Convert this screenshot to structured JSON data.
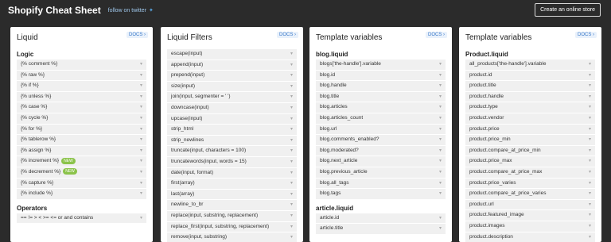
{
  "header": {
    "title": "Shopify Cheat Sheet",
    "twitter_label": "follow on twitter",
    "store_button": "Create an online store"
  },
  "panels": [
    {
      "title": "Liquid",
      "docs": "DOCS",
      "sections": [
        {
          "title": "Logic",
          "items": [
            {
              "label": "{% comment %}"
            },
            {
              "label": "{% raw %}"
            },
            {
              "label": "{% if %}"
            },
            {
              "label": "{% unless %}"
            },
            {
              "label": "{% case %}"
            },
            {
              "label": "{% cycle %}"
            },
            {
              "label": "{% for %}"
            },
            {
              "label": "{% tablerow %}"
            },
            {
              "label": "{% assign %}"
            },
            {
              "label": "{% increment %}",
              "badge": "NEW"
            },
            {
              "label": "{% decrement %}",
              "badge": "NEW"
            },
            {
              "label": "{% capture %}"
            },
            {
              "label": "{% include %}"
            }
          ]
        },
        {
          "title": "Operators",
          "items": [
            {
              "label": "== != > < >= <= or and contains"
            }
          ]
        }
      ]
    },
    {
      "title": "Liquid Filters",
      "docs": "DOCS",
      "sections": [
        {
          "title": "",
          "items": [
            {
              "label": "escape(input)"
            },
            {
              "label": "append(input)"
            },
            {
              "label": "prepend(input)"
            },
            {
              "label": "size(input)"
            },
            {
              "label": "join(input, segmenter = ' ')"
            },
            {
              "label": "downcase(input)"
            },
            {
              "label": "upcase(input)"
            },
            {
              "label": "strip_html"
            },
            {
              "label": "strip_newlines"
            },
            {
              "label": "truncate(input, characters = 100)"
            },
            {
              "label": "truncatewords(input, words = 15)"
            },
            {
              "label": "date(input, format)"
            },
            {
              "label": "first(array)"
            },
            {
              "label": "last(array)"
            },
            {
              "label": "newline_to_br"
            },
            {
              "label": "replace(input, substring, replacement)"
            },
            {
              "label": "replace_first(input, substring, replacement)"
            },
            {
              "label": "remove(input, substring)"
            }
          ]
        }
      ]
    },
    {
      "title": "Template variables",
      "docs": "DOCS",
      "sections": [
        {
          "title": "blog.liquid",
          "items": [
            {
              "label": "blogs['the-handle'].variable"
            },
            {
              "label": "blog.id"
            },
            {
              "label": "blog.handle"
            },
            {
              "label": "blog.title"
            },
            {
              "label": "blog.articles"
            },
            {
              "label": "blog.articles_count"
            },
            {
              "label": "blog.url"
            },
            {
              "label": "blog.comments_enabled?"
            },
            {
              "label": "blog.moderated?"
            },
            {
              "label": "blog.next_article"
            },
            {
              "label": "blog.previous_article"
            },
            {
              "label": "blog.all_tags"
            },
            {
              "label": "blog.tags"
            }
          ]
        },
        {
          "title": "article.liquid",
          "items": [
            {
              "label": "article.id"
            },
            {
              "label": "article.title"
            }
          ]
        }
      ]
    },
    {
      "title": "Template variables",
      "docs": "DOCS",
      "sections": [
        {
          "title": "Product.liquid",
          "items": [
            {
              "label": "all_products['the-handle'].variable"
            },
            {
              "label": "product.id"
            },
            {
              "label": "product.title"
            },
            {
              "label": "product.handle"
            },
            {
              "label": "product.type"
            },
            {
              "label": "product.vendor"
            },
            {
              "label": "product.price"
            },
            {
              "label": "product.price_min"
            },
            {
              "label": "product.compare_at_price_min"
            },
            {
              "label": "product.price_max"
            },
            {
              "label": "product.compare_at_price_max"
            },
            {
              "label": "product.price_varies"
            },
            {
              "label": "product.compare_at_price_varies"
            },
            {
              "label": "product.url"
            },
            {
              "label": "product.featured_image"
            },
            {
              "label": "product.images"
            },
            {
              "label": "product.description"
            }
          ]
        }
      ]
    }
  ]
}
